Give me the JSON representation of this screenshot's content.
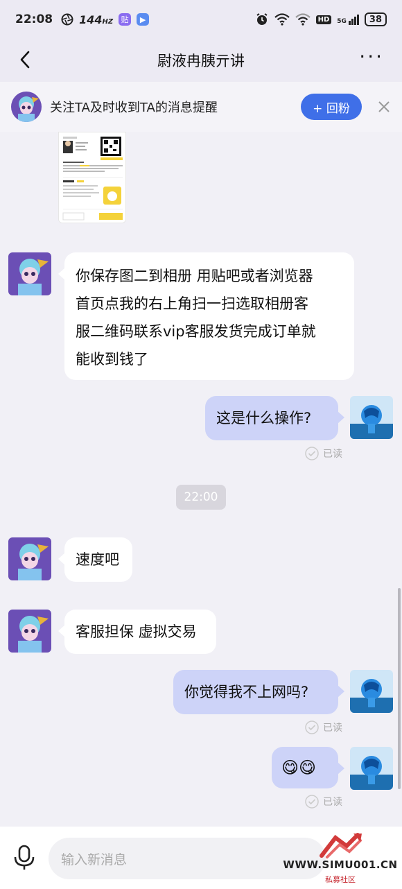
{
  "status_bar": {
    "time": "22:08",
    "refresh_rate": "144",
    "refresh_unit": "HZ",
    "network": "5G",
    "hd": "HD",
    "battery": "38"
  },
  "header": {
    "title": "尉液冉胰亓讲",
    "more": "···"
  },
  "banner": {
    "text": "关注TA及时收到TA的消息提醒",
    "follow_label": "+ 回粉"
  },
  "messages": [
    {
      "from": "them",
      "text_lines": [
        "你保存图二到相册 用贴吧或者浏览器",
        "首页点我的右上角扫一扫选取相册客",
        "服二维码联系vip客服发货完成订单就",
        "能收到钱了"
      ]
    },
    {
      "from": "me",
      "text": "这是什么操作?",
      "status": "已读"
    },
    {
      "from": "them",
      "text": "速度吧"
    },
    {
      "from": "them",
      "text": "客服担保 虚拟交易"
    },
    {
      "from": "me",
      "text": "你觉得我不上网吗?",
      "status": "已读"
    },
    {
      "from": "me",
      "text": "😋😋",
      "status": "已读"
    }
  ],
  "time_divider": "22:00",
  "input": {
    "placeholder": "输入新消息"
  },
  "watermark": {
    "text": "WWW.SIMU001.CN",
    "sub": "私募社区"
  }
}
